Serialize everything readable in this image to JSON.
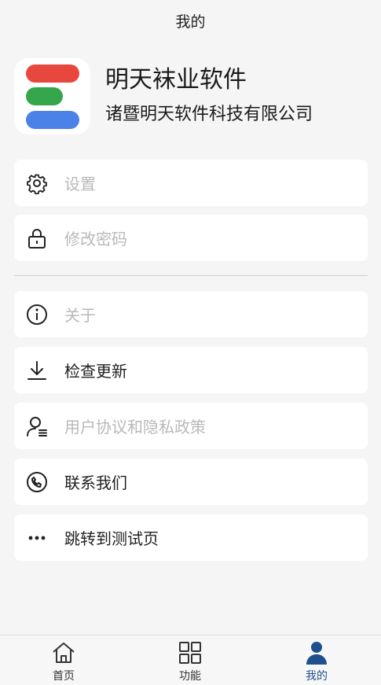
{
  "header": {
    "title": "我的"
  },
  "profile": {
    "app_name": "明天袜业软件",
    "company": "诸暨明天软件科技有限公司",
    "logo_icon": "app-logo-stripes",
    "logo_colors": [
      "#e8473d",
      "#35a64c",
      "#4b82e8"
    ]
  },
  "menu": {
    "settings": {
      "label": "设置",
      "icon": "gear-icon"
    },
    "change_password": {
      "label": "修改密码",
      "icon": "lock-icon"
    },
    "about": {
      "label": "关于",
      "icon": "info-icon"
    },
    "check_update": {
      "label": "检查更新",
      "icon": "download-icon"
    },
    "agreement": {
      "label": "用户协议和隐私政策",
      "icon": "user-document-icon"
    },
    "contact": {
      "label": "联系我们",
      "icon": "phone-icon"
    },
    "test_page": {
      "label": "跳转到测试页",
      "icon": "more-dots-icon"
    }
  },
  "tabbar": {
    "home": {
      "label": "首页",
      "icon": "home-icon"
    },
    "features": {
      "label": "功能",
      "icon": "grid-icon"
    },
    "mine": {
      "label": "我的",
      "icon": "person-icon",
      "active": true
    }
  },
  "colors": {
    "background": "#f5f5f5",
    "card": "#ffffff",
    "muted_text": "#b9b9b9",
    "active_tab": "#1f4f8c"
  }
}
